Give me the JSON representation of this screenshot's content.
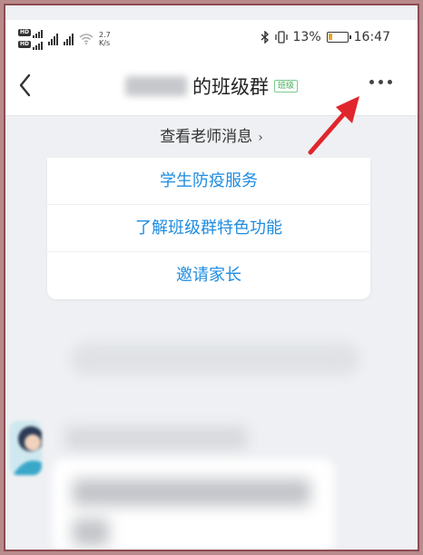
{
  "statusbar": {
    "speed_value": "2.7",
    "speed_unit": "K/s",
    "battery": "13%",
    "battery_level": 0.13,
    "time": "16:47"
  },
  "nav": {
    "title_suffix": "的班级群",
    "tag": "班级",
    "more_label": "•••"
  },
  "teacher_link": {
    "label": "查看老师消息",
    "chevron": "›"
  },
  "menu": [
    {
      "label": "学生防疫服务"
    },
    {
      "label": "了解班级群特色功能"
    },
    {
      "label": "邀请家长"
    }
  ],
  "colors": {
    "link_blue": "#1f8ce0",
    "tag_green": "#3fae55",
    "annotation_red": "#e0262c",
    "battery_orange": "#f0a12d"
  }
}
